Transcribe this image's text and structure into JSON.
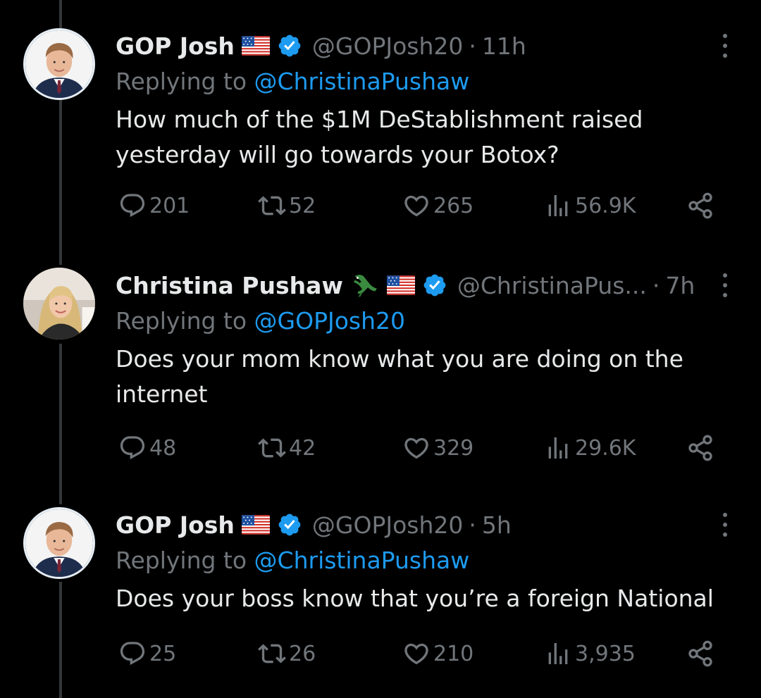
{
  "tweets": [
    {
      "name": "GOP Josh",
      "flag_emoji": "🇺🇸",
      "handle": "@GOPJosh20",
      "time": "11h",
      "reply_prefix": "Replying to",
      "reply_to": "@ChristinaPushaw",
      "text": "How much of the $1M DeStablishment raised yesterday will go towards your Botox?",
      "stats": {
        "replies": "201",
        "reposts": "52",
        "likes": "265",
        "views": "56.9K"
      }
    },
    {
      "name": "Christina Pushaw",
      "extra_emoji": "🐊",
      "flag_emoji": "🇺🇸",
      "handle": "@ChristinaPus...",
      "time": "7h",
      "reply_prefix": "Replying to",
      "reply_to": "@GOPJosh20",
      "text": "Does your mom know what you are doing on the internet",
      "stats": {
        "replies": "48",
        "reposts": "42",
        "likes": "329",
        "views": "29.6K"
      }
    },
    {
      "name": "GOP Josh",
      "flag_emoji": "🇺🇸",
      "handle": "@GOPJosh20",
      "time": "5h",
      "reply_prefix": "Replying to",
      "reply_to": "@ChristinaPushaw",
      "text": "Does your boss know that you’re a foreign National",
      "stats": {
        "replies": "25",
        "reposts": "26",
        "likes": "210",
        "views": "3,935"
      }
    }
  ],
  "separator": "·",
  "icons": {
    "verified": "verified-badge-icon",
    "flag": "us-flag-icon",
    "crocodile": "crocodile-icon",
    "reply": "reply-bubble-icon",
    "repost": "repost-icon",
    "like": "heart-icon",
    "views": "views-chart-icon",
    "share": "share-icon",
    "more": "more-options-icon"
  },
  "colors": {
    "background": "#000000",
    "text": "#e7e9ea",
    "muted": "#71767b",
    "accent": "#1d9bf0",
    "thread_line": "#333639"
  }
}
